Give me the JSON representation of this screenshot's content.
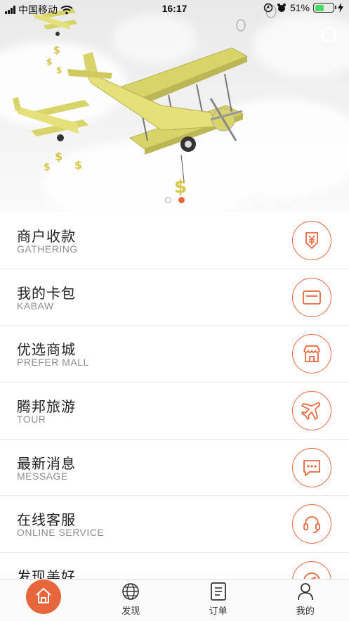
{
  "status_bar": {
    "carrier": "中国移动",
    "time": "16:17",
    "battery_percent": "51%",
    "battery_level": 0.51
  },
  "banner": {
    "slide_count": 2,
    "active_slide": 2
  },
  "menu": [
    {
      "title": "商户收款",
      "subtitle": "GATHERING",
      "icon": "yen-receipt-icon"
    },
    {
      "title": "我的卡包",
      "subtitle": "KABAW",
      "icon": "card-icon"
    },
    {
      "title": "优选商城",
      "subtitle": "PREFER MALL",
      "icon": "store-icon"
    },
    {
      "title": "腾邦旅游",
      "subtitle": "TOUR",
      "icon": "airplane-icon"
    },
    {
      "title": "最新消息",
      "subtitle": "MESSAGE",
      "icon": "message-icon"
    },
    {
      "title": "在线客服",
      "subtitle": "ONLINE SERVICE",
      "icon": "headset-icon"
    },
    {
      "title": "发现美好",
      "subtitle": "",
      "icon": "compass-icon"
    }
  ],
  "tabbar": {
    "items": [
      {
        "label": "",
        "icon": "home-icon"
      },
      {
        "label": "发现",
        "icon": "globe-icon"
      },
      {
        "label": "订单",
        "icon": "order-icon"
      },
      {
        "label": "我的",
        "icon": "user-icon"
      }
    ]
  },
  "colors": {
    "accent": "#e8663c",
    "plane_yellow": "#dcd876"
  }
}
